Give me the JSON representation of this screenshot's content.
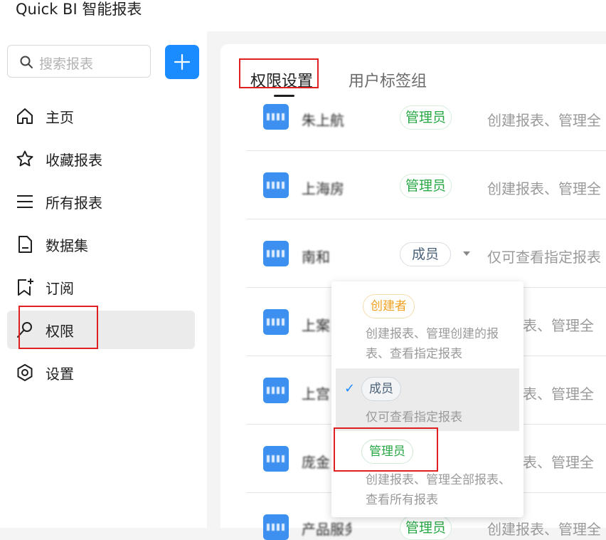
{
  "app": {
    "title": "Quick BI 智能报表"
  },
  "search": {
    "placeholder": "搜索报表",
    "icon": "search-icon"
  },
  "add_button": {
    "icon": "plus-icon",
    "color": "#1a8cff"
  },
  "sidebar": {
    "items": [
      {
        "label": "主页",
        "icon": "home-icon"
      },
      {
        "label": "收藏报表",
        "icon": "star-icon"
      },
      {
        "label": "所有报表",
        "icon": "menu-icon"
      },
      {
        "label": "数据集",
        "icon": "file-icon"
      },
      {
        "label": "订阅",
        "icon": "bookmark-add-icon"
      },
      {
        "label": "权限",
        "icon": "key-icon",
        "active": true
      },
      {
        "label": "设置",
        "icon": "settings-icon"
      }
    ]
  },
  "tabs": [
    {
      "label": "权限设置",
      "active": true
    },
    {
      "label": "用户标签组",
      "active": false
    }
  ],
  "rows": [
    {
      "name": "朱上航",
      "role": "管理员",
      "description": "创建报表、管理全"
    },
    {
      "name": "上海房",
      "role": "管理员",
      "description": "创建报表、管理全"
    },
    {
      "name": "南和",
      "role": "成员",
      "description": "仅可查看指定报表"
    },
    {
      "name": "上案",
      "role": "",
      "description": "表、管理全"
    },
    {
      "name": "上宫",
      "role": "",
      "description": "表、管理全"
    },
    {
      "name": "庞金",
      "role": "",
      "description": "表、管理全"
    },
    {
      "name": "产品服务",
      "role": "管理员",
      "description": "创建报表、管理全"
    }
  ],
  "role_dropdown": {
    "options": [
      {
        "label": "创建者",
        "description": "创建报表、管理创建的报表、查看指定报表",
        "selected": false
      },
      {
        "label": "成员",
        "description": "仅可查看指定报表",
        "selected": true
      },
      {
        "label": "管理员",
        "description": "创建报表、管理全部报表、查看所有报表",
        "selected": false
      }
    ]
  },
  "colors": {
    "accent": "#1a8cff",
    "admin": "#28a745",
    "creator": "#f0a020",
    "highlight": "#e02020"
  }
}
